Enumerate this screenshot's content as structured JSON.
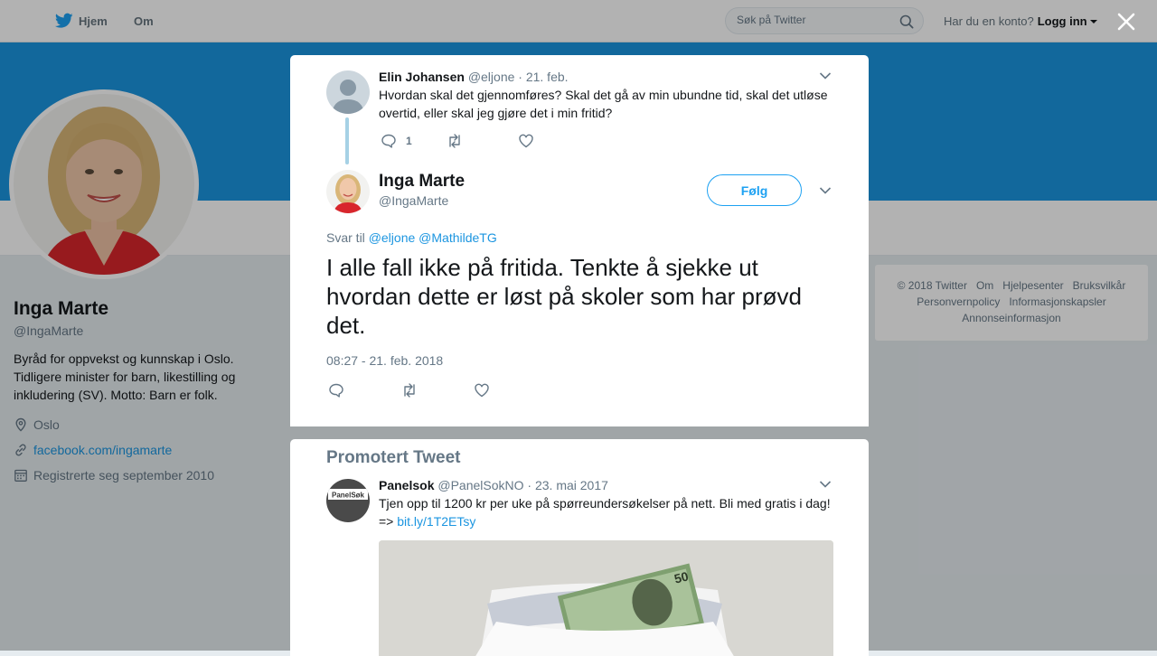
{
  "nav": {
    "home_label": "Hjem",
    "about_label": "Om",
    "search_placeholder": "Søk på Twitter",
    "account_prompt": "Har du en konto?",
    "login_label": "Logg inn"
  },
  "profile": {
    "name": "Inga Marte",
    "handle": "@IngaMarte",
    "bio": "Byråd for oppvekst og kunnskap i Oslo. Tidligere minister for barn, likestilling og inkludering (SV). Motto: Barn er folk.",
    "location": "Oslo",
    "website": "facebook.com/ingamarte",
    "joined": "Registrerte seg september 2010"
  },
  "footer": {
    "links": [
      "© 2018 Twitter",
      "Om",
      "Hjelpesenter",
      "Bruksvilkår",
      "Personvernpolicy",
      "Informasjonskapsler",
      "Annonseinformasjon"
    ]
  },
  "parent_tweet": {
    "name": "Elin Johansen",
    "handle": "@eljone",
    "date": "· 21. feb.",
    "text": "Hvordan skal det gjennomføres? Skal det gå av min ubundne tid, skal det utløse overtid, eller skal jeg gjøre det i min fritid?",
    "reply_count": "1"
  },
  "main_tweet": {
    "name": "Inga Marte",
    "handle": "@IngaMarte",
    "follow_label": "Følg",
    "reply_prefix": "Svar til",
    "reply_mention_1": "@eljone",
    "reply_mention_2": "@MathildeTG",
    "text": "I alle fall ikke på fritida. Tenkte å sjekke ut hvordan dette er løst på skoler som har prøvd det.",
    "timestamp": "08:27 - 21. feb. 2018"
  },
  "promoted": {
    "title": "Promotert Tweet",
    "name": "Panelsok",
    "handle": "@PanelSokNO",
    "date": "· 23. mai 2017",
    "text": "Tjen opp til 1200 kr per uke på spørreundersøkelser på nett. Bli med gratis i dag! =>",
    "link": "bit.ly/1T2ETsy",
    "logo_text": "PanelSøk",
    "banknote_text": "50"
  },
  "colors": {
    "brand_blue": "#1da1f2",
    "banner": "#1b95e0",
    "thread_line": "#a6d1e5",
    "secondary_text": "#657786"
  },
  "icons": [
    "twitter-bird-icon",
    "search-icon",
    "close-icon",
    "chevron-down-icon",
    "reply-icon",
    "retweet-icon",
    "like-icon",
    "location-icon",
    "link-icon",
    "calendar-icon"
  ]
}
